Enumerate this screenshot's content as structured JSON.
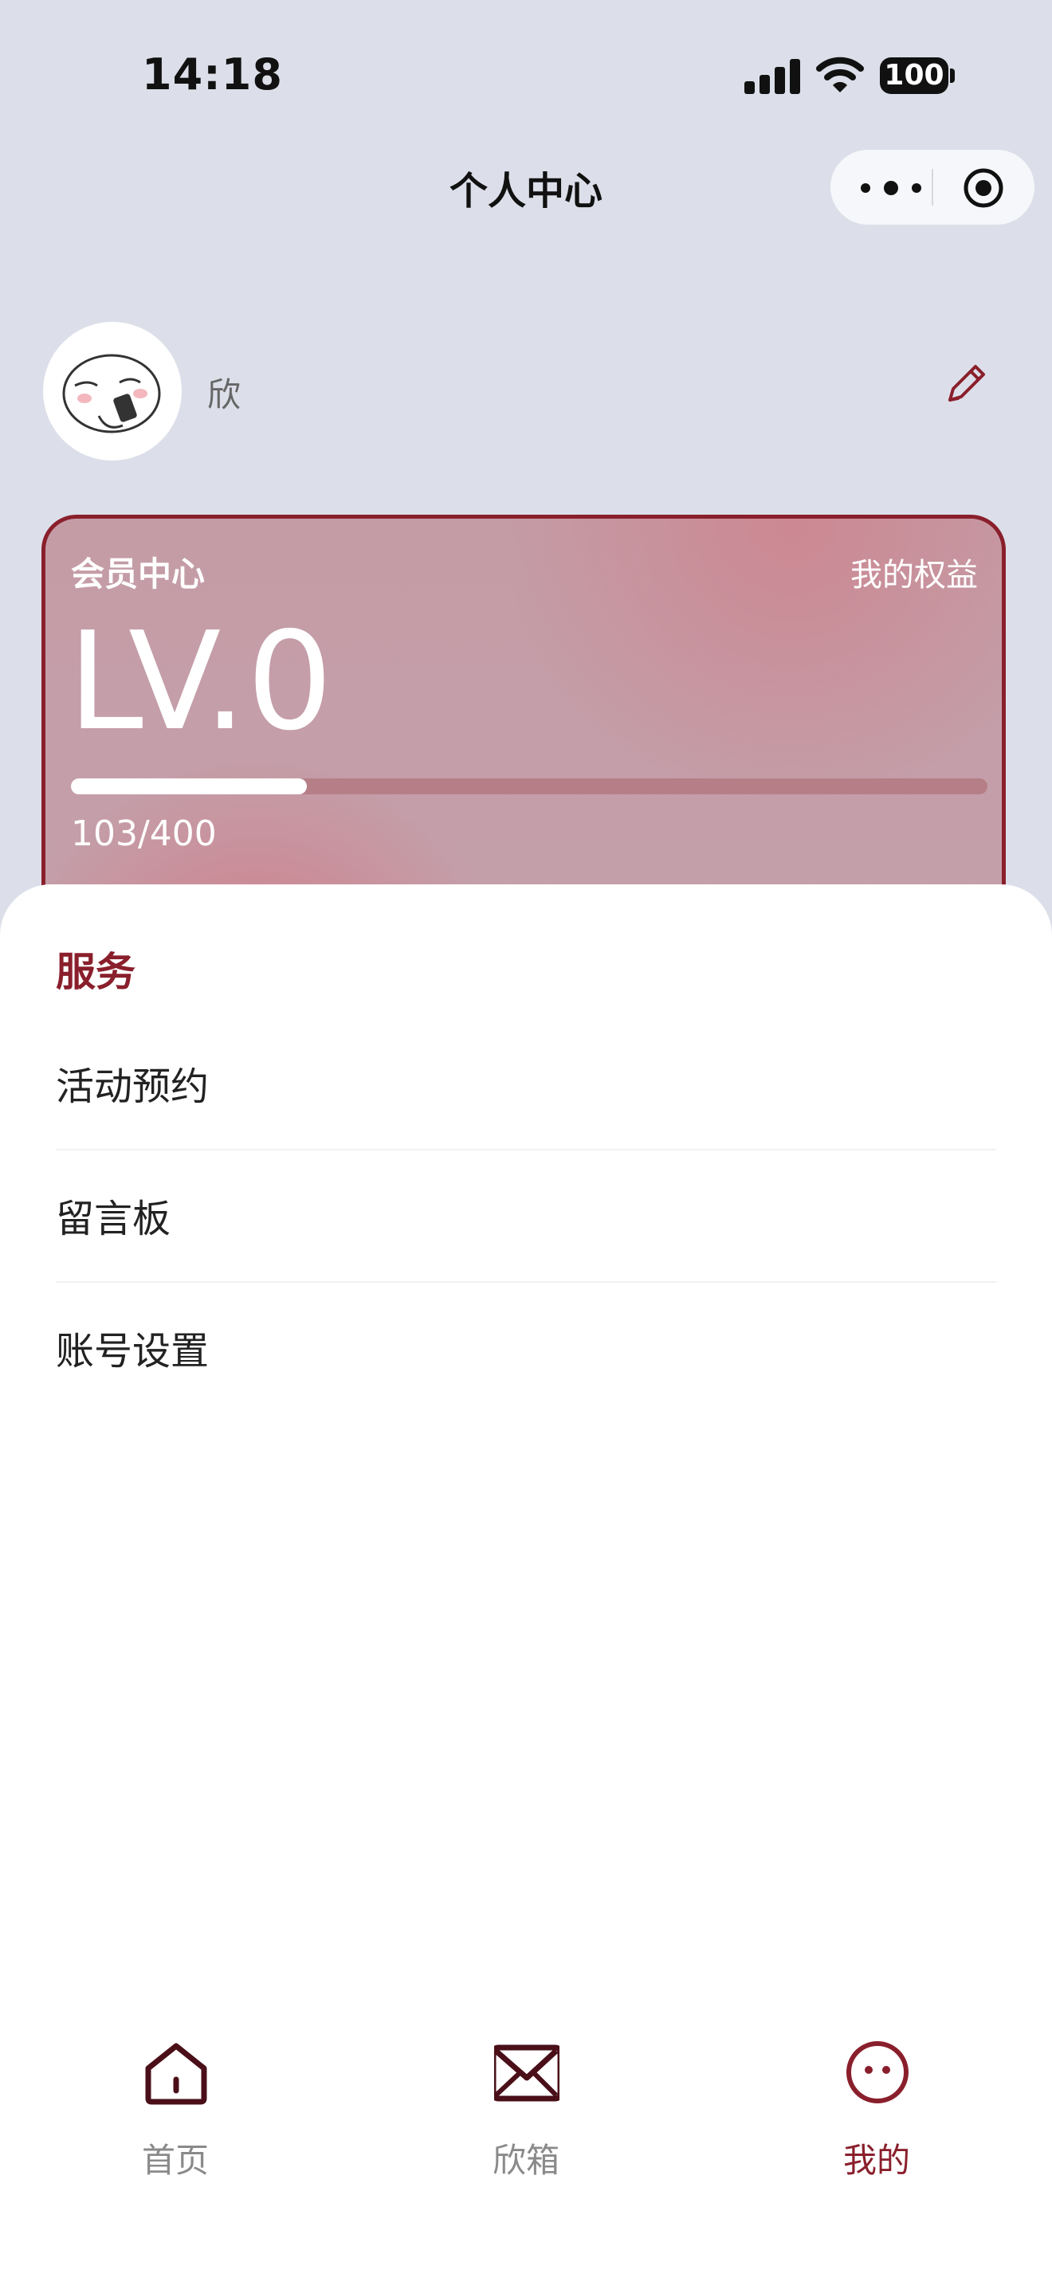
{
  "status_bar": {
    "time": "14:18",
    "battery": "100"
  },
  "nav": {
    "title": "个人中心",
    "more_icon": "more-dots-icon",
    "close_icon": "target-icon"
  },
  "profile": {
    "name": "欣",
    "edit_icon": "pencil-icon"
  },
  "member_card": {
    "title": "会员中心",
    "benefits_label": "我的权益",
    "level": "LV.0",
    "progress_text": "103/400",
    "progress_fraction": 0.2575
  },
  "services": {
    "title": "服务",
    "items": [
      {
        "label": "活动预约"
      },
      {
        "label": "留言板"
      },
      {
        "label": "账号设置"
      }
    ]
  },
  "tab_bar": {
    "items": [
      {
        "label": "首页",
        "icon": "home-icon",
        "active": false
      },
      {
        "label": "欣箱",
        "icon": "mail-icon",
        "active": false
      },
      {
        "label": "我的",
        "icon": "smile-face-icon",
        "active": true
      }
    ]
  },
  "colors": {
    "accent": "#8a1f2c",
    "background": "#dcdfe9",
    "card": "#c4a0aa"
  }
}
